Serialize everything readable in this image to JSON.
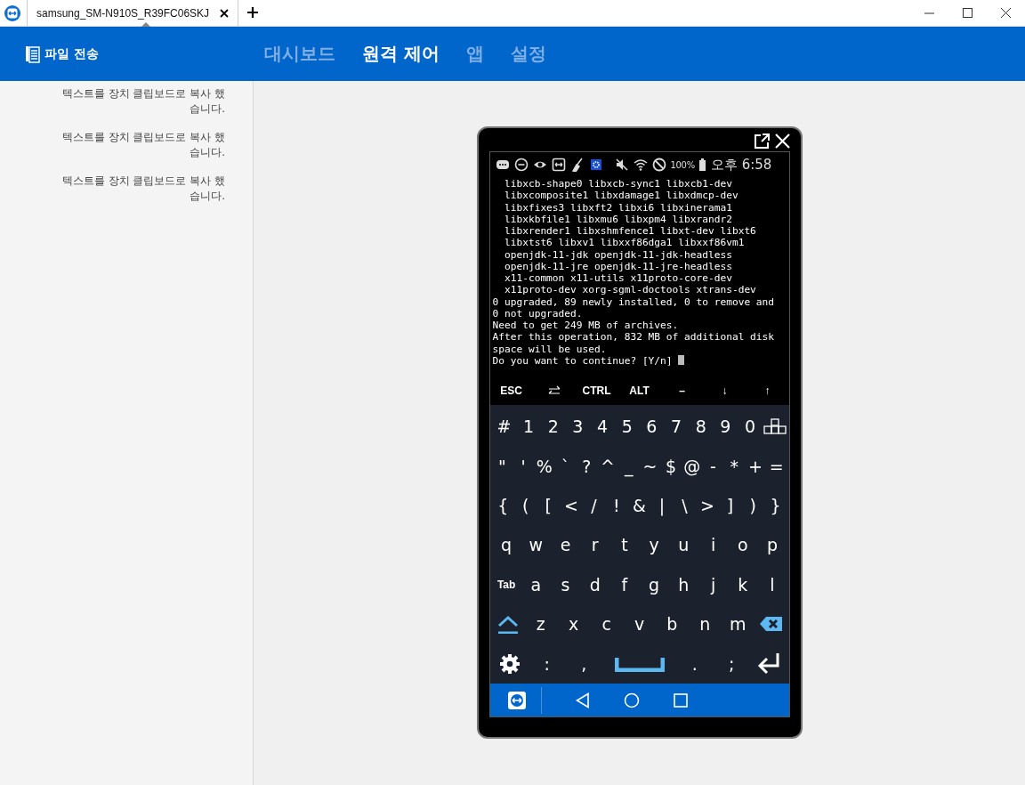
{
  "window": {
    "tabs": [
      {
        "label": "samsung_SM-N910S_R39FC06SKJ",
        "selected": true
      }
    ]
  },
  "header": {
    "title": "파일 전송",
    "nav": [
      {
        "label": "대시보드",
        "selected": false
      },
      {
        "label": "원격 제어",
        "selected": true
      },
      {
        "label": "앱",
        "selected": false
      },
      {
        "label": "설정",
        "selected": false
      }
    ]
  },
  "sidebar": {
    "messages": [
      "텍스트를 장치 클립보드로 복사 했습니다.",
      "텍스트를 장치 클립보드로 복사 했습니다.",
      "텍스트를 장치 클립보드로 복사 했습니다."
    ]
  },
  "phone": {
    "status": {
      "battery": "100%",
      "time": "오후 6:58"
    },
    "terminal": [
      "  libxcb-shape0 libxcb-sync1 libxcb1-dev",
      "  libxcomposite1 libxdamage1 libxdmcp-dev",
      "  libxfixes3 libxft2 libxi6 libxinerama1",
      "  libxkbfile1 libxmu6 libxpm4 libxrandr2",
      "  libxrender1 libxshmfence1 libxt-dev libxt6",
      "  libxtst6 libxv1 libxxf86dga1 libxxf86vm1",
      "  openjdk-11-jdk openjdk-11-jdk-headless",
      "  openjdk-11-jre openjdk-11-jre-headless",
      "  x11-common x11-utils x11proto-core-dev",
      "  x11proto-dev xorg-sgml-doctools xtrans-dev",
      "0 upgraded, 89 newly installed, 0 to remove and",
      "0 not upgraded.",
      "Need to get 249 MB of archives.",
      "After this operation, 832 MB of additional disk",
      "space will be used.",
      "Do you want to continue? [Y/n] "
    ],
    "extra_keys": [
      {
        "kind": "char",
        "label": "ESC"
      },
      {
        "kind": "swap"
      },
      {
        "kind": "char",
        "label": "CTRL"
      },
      {
        "kind": "char",
        "label": "ALT"
      },
      {
        "kind": "char",
        "label": "–"
      },
      {
        "kind": "char",
        "label": "↓"
      },
      {
        "kind": "char",
        "label": "↑"
      }
    ],
    "keyboard": [
      [
        {
          "kind": "char",
          "label": "#"
        },
        {
          "kind": "char",
          "label": "1"
        },
        {
          "kind": "char",
          "label": "2"
        },
        {
          "kind": "char",
          "label": "3"
        },
        {
          "kind": "char",
          "label": "4"
        },
        {
          "kind": "char",
          "label": "5"
        },
        {
          "kind": "char",
          "label": "6"
        },
        {
          "kind": "char",
          "label": "7"
        },
        {
          "kind": "char",
          "label": "8"
        },
        {
          "kind": "char",
          "label": "9"
        },
        {
          "kind": "char",
          "label": "0"
        },
        {
          "kind": "layout"
        }
      ],
      [
        {
          "kind": "char",
          "label": "\""
        },
        {
          "kind": "char",
          "label": "'"
        },
        {
          "kind": "char",
          "label": "%"
        },
        {
          "kind": "char",
          "label": "`"
        },
        {
          "kind": "char",
          "label": "?"
        },
        {
          "kind": "char",
          "label": "^"
        },
        {
          "kind": "char",
          "label": "_"
        },
        {
          "kind": "char",
          "label": "~"
        },
        {
          "kind": "char",
          "label": "$"
        },
        {
          "kind": "char",
          "label": "@"
        },
        {
          "kind": "char",
          "label": "-"
        },
        {
          "kind": "char",
          "label": "*"
        },
        {
          "kind": "char",
          "label": "+"
        },
        {
          "kind": "char",
          "label": "="
        }
      ],
      [
        {
          "kind": "char",
          "label": "{"
        },
        {
          "kind": "char",
          "label": "("
        },
        {
          "kind": "char",
          "label": "["
        },
        {
          "kind": "char",
          "label": "<"
        },
        {
          "kind": "char",
          "label": "/"
        },
        {
          "kind": "char",
          "label": "!"
        },
        {
          "kind": "char",
          "label": "&"
        },
        {
          "kind": "char",
          "label": "|"
        },
        {
          "kind": "char",
          "label": "\\"
        },
        {
          "kind": "char",
          "label": ">"
        },
        {
          "kind": "char",
          "label": "]"
        },
        {
          "kind": "char",
          "label": ")"
        },
        {
          "kind": "char",
          "label": "}"
        }
      ],
      [
        {
          "kind": "char",
          "label": "q"
        },
        {
          "kind": "char",
          "label": "w"
        },
        {
          "kind": "char",
          "label": "e"
        },
        {
          "kind": "char",
          "label": "r"
        },
        {
          "kind": "char",
          "label": "t"
        },
        {
          "kind": "char",
          "label": "y"
        },
        {
          "kind": "char",
          "label": "u"
        },
        {
          "kind": "char",
          "label": "i"
        },
        {
          "kind": "char",
          "label": "o"
        },
        {
          "kind": "char",
          "label": "p"
        }
      ],
      [
        {
          "kind": "small",
          "label": "Tab"
        },
        {
          "kind": "char",
          "label": "a"
        },
        {
          "kind": "char",
          "label": "s"
        },
        {
          "kind": "char",
          "label": "d"
        },
        {
          "kind": "char",
          "label": "f"
        },
        {
          "kind": "char",
          "label": "g"
        },
        {
          "kind": "char",
          "label": "h"
        },
        {
          "kind": "char",
          "label": "j"
        },
        {
          "kind": "char",
          "label": "k"
        },
        {
          "kind": "char",
          "label": "l"
        }
      ],
      [
        {
          "kind": "shift"
        },
        {
          "kind": "char",
          "label": "z"
        },
        {
          "kind": "char",
          "label": "x"
        },
        {
          "kind": "char",
          "label": "c"
        },
        {
          "kind": "char",
          "label": "v"
        },
        {
          "kind": "char",
          "label": "b"
        },
        {
          "kind": "char",
          "label": "n"
        },
        {
          "kind": "char",
          "label": "m"
        },
        {
          "kind": "backspace"
        }
      ],
      [
        {
          "kind": "settings"
        },
        {
          "kind": "char",
          "label": ":"
        },
        {
          "kind": "char",
          "label": ","
        },
        {
          "kind": "space"
        },
        {
          "kind": "char",
          "label": "."
        },
        {
          "kind": "char",
          "label": ";"
        },
        {
          "kind": "enter"
        }
      ]
    ]
  }
}
